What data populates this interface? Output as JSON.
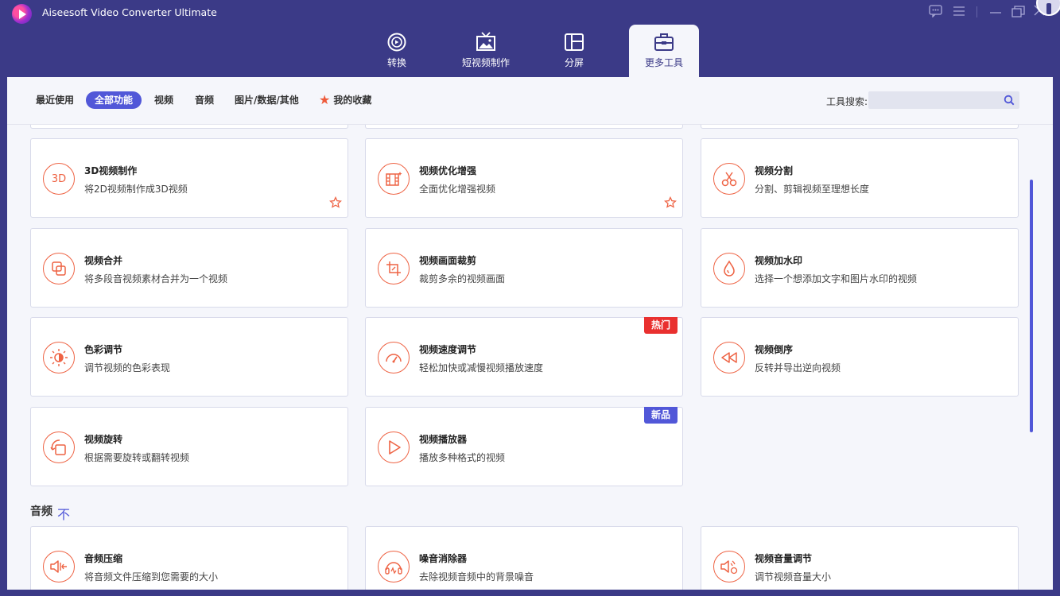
{
  "app": {
    "title": "Aiseesoft Video Converter Ultimate"
  },
  "nav": [
    {
      "label": "转换",
      "icon": "convert-icon"
    },
    {
      "label": "短视频制作",
      "icon": "mv-icon"
    },
    {
      "label": "分屏",
      "icon": "collage-icon"
    },
    {
      "label": "更多工具",
      "icon": "toolbox-icon"
    }
  ],
  "filters": {
    "recent": "最近使用",
    "all": "全部功能",
    "video": "视频",
    "audio": "音频",
    "other": "图片/数据/其他",
    "favorites": "我的收藏"
  },
  "search": {
    "label": "工具搜索:",
    "placeholder": ""
  },
  "tools": [
    {
      "title": "3D视频制作",
      "desc": "将2D视频制作成3D视频",
      "icon": "3d-icon"
    },
    {
      "title": "视频优化增强",
      "desc": "全面优化增强视频",
      "icon": "enhance-icon"
    },
    {
      "title": "视频分割",
      "desc": "分割、剪辑视频至理想长度",
      "icon": "scissors-icon"
    },
    {
      "title": "视频合并",
      "desc": "将多段音视频素材合并为一个视频",
      "icon": "merge-icon"
    },
    {
      "title": "视频画面裁剪",
      "desc": "裁剪多余的视频画面",
      "icon": "crop-icon"
    },
    {
      "title": "视频加水印",
      "desc": "选择一个想添加文字和图片水印的视频",
      "icon": "watermark-icon"
    },
    {
      "title": "色彩调节",
      "desc": "调节视频的色彩表现",
      "icon": "color-icon"
    },
    {
      "title": "视频速度调节",
      "desc": "轻松加快或减慢视频播放速度",
      "icon": "speed-icon",
      "badge": "热门"
    },
    {
      "title": "视频倒序",
      "desc": "反转并导出逆向视频",
      "icon": "reverse-icon"
    },
    {
      "title": "视频旋转",
      "desc": "根据需要旋转或翻转视频",
      "icon": "rotate-icon"
    },
    {
      "title": "视频播放器",
      "desc": "播放多种格式的视频",
      "icon": "play-icon",
      "badge": "新品"
    }
  ],
  "audio_section": {
    "title": "音频",
    "collapse": "不"
  },
  "audio_tools": [
    {
      "title": "音频压缩",
      "desc": "将音频文件压缩到您需要的大小",
      "icon": "audio-compress-icon"
    },
    {
      "title": "噪音消除器",
      "desc": "去除视频音频中的背景噪音",
      "icon": "noise-icon"
    },
    {
      "title": "视频音量调节",
      "desc": "调节视频音量大小",
      "icon": "volume-icon"
    }
  ],
  "colors": {
    "accent": "#5157d8",
    "brand_bg": "#3b3a87",
    "icon": "#ee6344",
    "hot": "#e9302f"
  }
}
